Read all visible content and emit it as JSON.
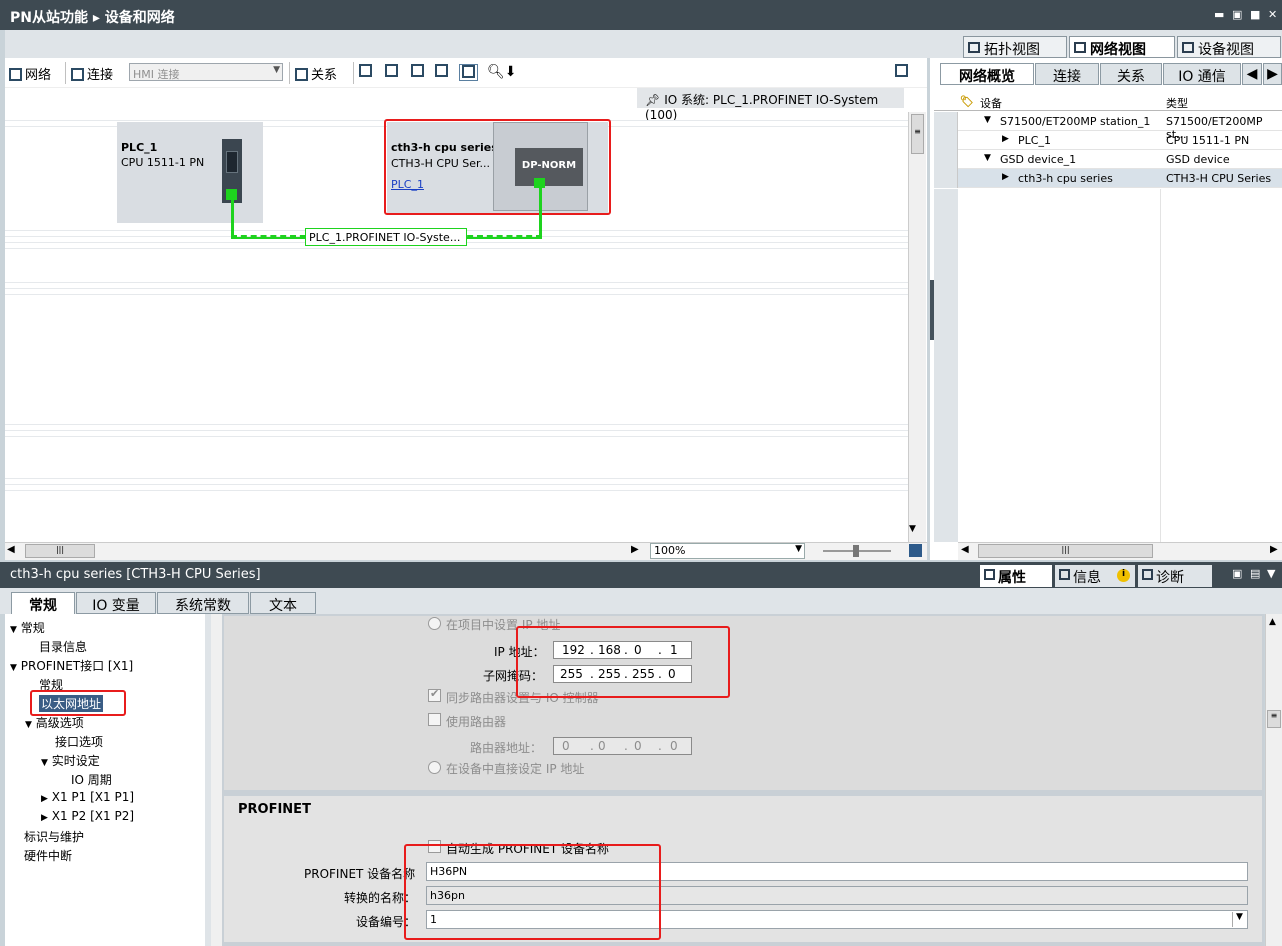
{
  "title": {
    "app": "PN从站功能",
    "arrow": "▸",
    "page": "设备和网络"
  },
  "views": {
    "topology": "拓扑视图",
    "network": "网络视图",
    "device": "设备视图"
  },
  "toolbar": {
    "network": "网络",
    "connect": "连接",
    "hmi_select": "HMI 连接",
    "relation": "关系"
  },
  "io_system_label": "IO 系统: PLC_1.PROFINET IO-System (100)",
  "devices": {
    "plc": {
      "name": "PLC_1",
      "type": "CPU 1511-1 PN"
    },
    "cth": {
      "name": "cth3-h cpu series",
      "type": "CTH3-H CPU Ser...",
      "link": "PLC_1",
      "module": "DP-NORM"
    }
  },
  "network_label": "PLC_1.PROFINET IO-Syste...",
  "zoom": "100%",
  "overview": {
    "tabs": [
      "网络概览",
      "连接",
      "关系",
      "IO 通信"
    ],
    "columns": {
      "device": "设备",
      "type": "类型"
    },
    "rows": [
      {
        "device": "S71500/ET200MP station_1",
        "type": "S71500/ET200MP st...",
        "expanded": true
      },
      {
        "device": "PLC_1",
        "type": "CPU 1511-1 PN"
      },
      {
        "device": "GSD device_1",
        "type": "GSD device",
        "expanded": true
      },
      {
        "device": "cth3-h cpu series",
        "type": "CTH3-H CPU Series"
      }
    ]
  },
  "properties": {
    "title": "cth3-h cpu series [CTH3-H CPU Series]",
    "right_tabs": {
      "props": "属性",
      "info": "信息",
      "diag": "诊断"
    },
    "tabs": [
      "常规",
      "IO 变量",
      "系统常数",
      "文本"
    ],
    "nav": {
      "general": "常规",
      "catalog": "目录信息",
      "profinet": "PROFINET接口 [X1]",
      "pn_general": "常规",
      "ethernet": "以太网地址",
      "advanced": "高级选项",
      "iface_opts": "接口选项",
      "realtime": "实时设定",
      "io_cycle": "IO 周期",
      "p1": "X1 P1 [X1 P1]",
      "p2": "X1 P2 [X1 P2]",
      "ident": "标识与维护",
      "hw_int": "硬件中断"
    },
    "ip": {
      "set_in_project": "在项目中设置 IP 地址",
      "ip_label": "IP 地址：",
      "ip": [
        "192",
        "168",
        "0",
        "1"
      ],
      "mask_label": "子网掩码：",
      "mask": [
        "255",
        "255",
        "255",
        "0"
      ],
      "sync_router": "同步路由器设置与 IO 控制器",
      "use_router": "使用路由器",
      "router_label": "路由器地址：",
      "router": [
        "0",
        "0",
        "0",
        "0"
      ],
      "set_on_device": "在设备中直接设定 IP 地址"
    },
    "profinet": {
      "heading": "PROFINET",
      "auto_name": "自动生成 PROFINET 设备名称",
      "name_label": "PROFINET 设备名称",
      "name": "H36PN",
      "converted_label": "转换的名称：",
      "converted": "h36pn",
      "number_label": "设备编号：",
      "number": "1"
    }
  }
}
